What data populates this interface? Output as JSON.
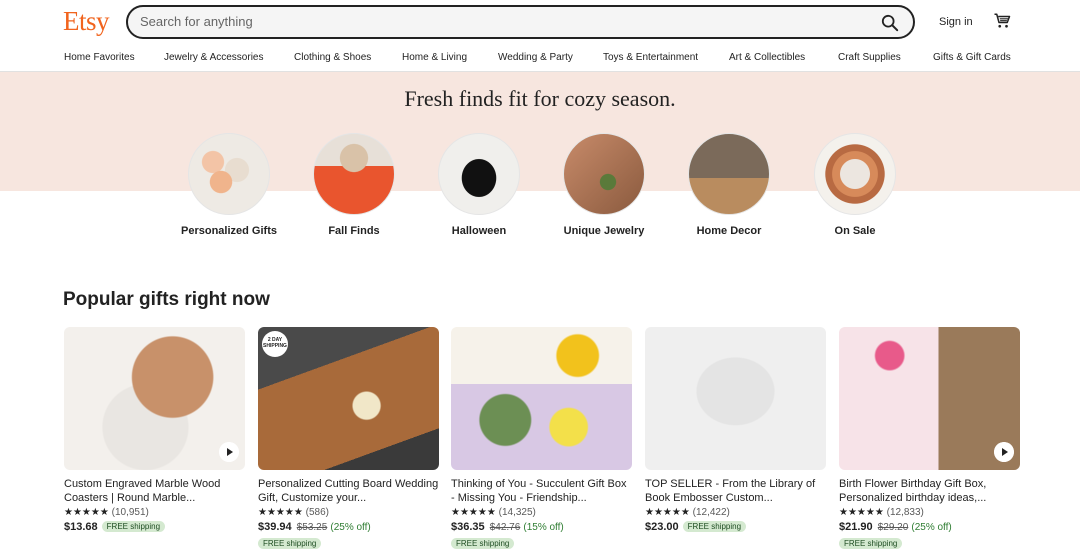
{
  "header": {
    "logo": "Etsy",
    "search_placeholder": "Search for anything",
    "sign_in": "Sign in"
  },
  "nav": [
    "Home Favorites",
    "Jewelry & Accessories",
    "Clothing & Shoes",
    "Home & Living",
    "Wedding & Party",
    "Toys & Entertainment",
    "Art & Collectibles",
    "Craft Supplies",
    "Gifts & Gift Cards"
  ],
  "hero": {
    "title": "Fresh finds fit for cozy season.",
    "categories": [
      {
        "label": "Personalized Gifts"
      },
      {
        "label": "Fall Finds"
      },
      {
        "label": "Halloween"
      },
      {
        "label": "Unique Jewelry"
      },
      {
        "label": "Home Decor"
      },
      {
        "label": "On Sale"
      }
    ]
  },
  "section": {
    "title": "Popular gifts right now"
  },
  "products": [
    {
      "title": "Custom Engraved Marble Wood Coasters | Round Marble...",
      "stars": "★★★★★",
      "count": "(10,951)",
      "price": "$13.68",
      "orig": "",
      "disc": "",
      "ship": "FREE shipping"
    },
    {
      "title": "Personalized Cutting Board Wedding Gift, Customize your...",
      "stars": "★★★★★",
      "count": "(586)",
      "price": "$39.94",
      "orig": "$53.25",
      "disc": "(25% off)",
      "ship": "FREE shipping",
      "badge": "2 DAY SHIPPING"
    },
    {
      "title": "Thinking of You - Succulent Gift Box - Missing You - Friendship...",
      "stars": "★★★★★",
      "count": "(14,325)",
      "price": "$36.35",
      "orig": "$42.76",
      "disc": "(15% off)",
      "ship": "FREE shipping"
    },
    {
      "title": "TOP SELLER - From the Library of Book Embosser Custom...",
      "stars": "★★★★★",
      "count": "(12,422)",
      "price": "$23.00",
      "orig": "",
      "disc": "",
      "ship": "FREE shipping"
    },
    {
      "title": "Birth Flower Birthday Gift Box, Personalized birthday ideas,...",
      "stars": "★★★★★",
      "count": "(12,833)",
      "price": "$21.90",
      "orig": "$29.20",
      "disc": "(25% off)",
      "ship": "FREE shipping"
    }
  ],
  "colors": {
    "brand": "#f1641e",
    "hero_bg": "#f7e6df"
  }
}
